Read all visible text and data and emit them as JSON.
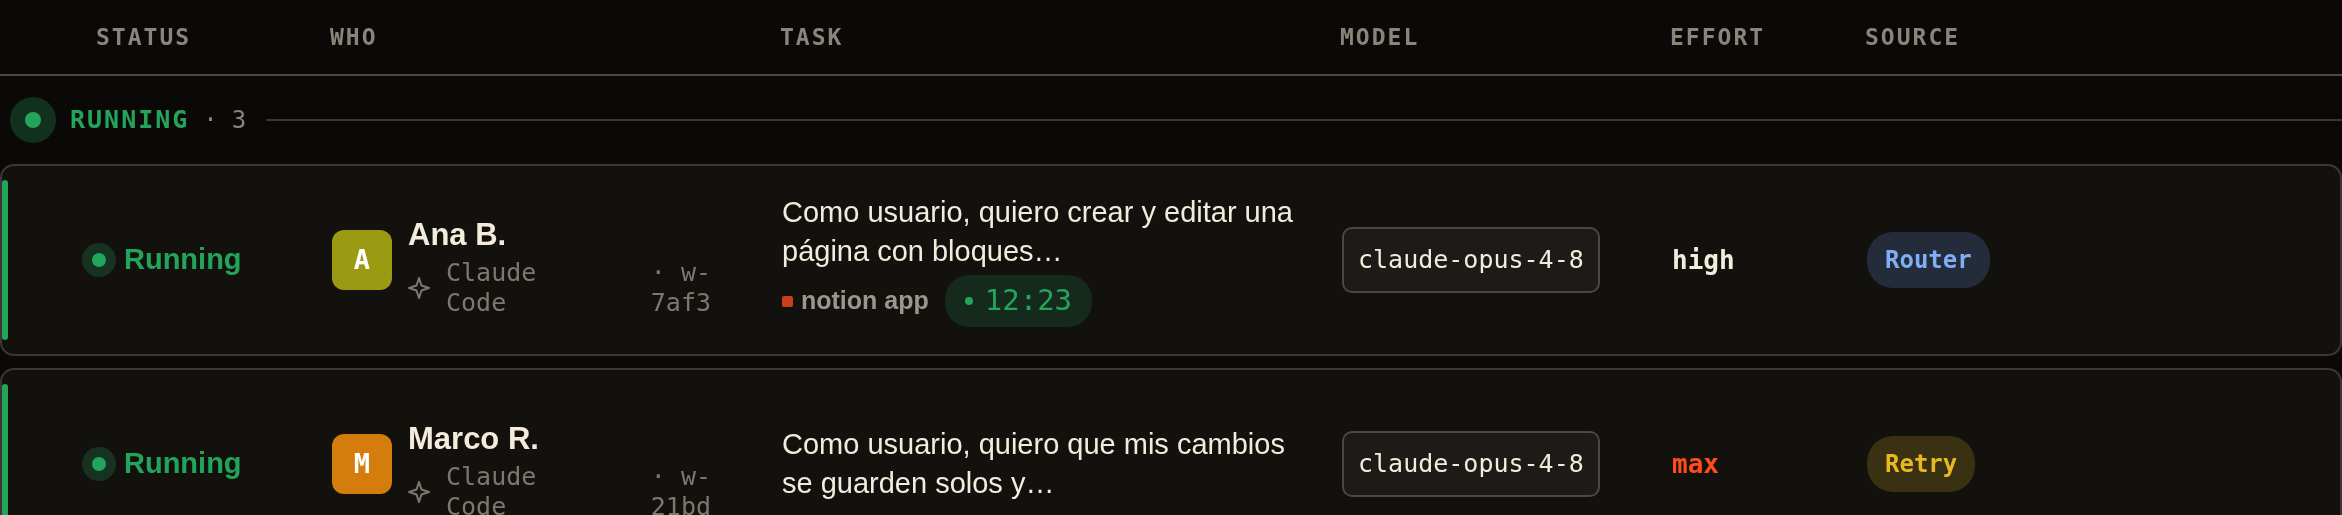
{
  "columns": [
    "STATUS",
    "WHO",
    "TASK",
    "MODEL",
    "EFFORT",
    "SOURCE"
  ],
  "group": {
    "kind": "running",
    "label": "RUNNING",
    "separator": "·",
    "count": "3"
  },
  "rows": [
    {
      "status": {
        "kind": "running",
        "label": "Running"
      },
      "avatar": {
        "initial": "A",
        "color": "#9c9a12"
      },
      "name": "Ana B.",
      "agent": "Claude Code",
      "session": "· w-7af3",
      "task": "Como usuario, quiero crear y editar una página con bloques…",
      "project": {
        "label": "notion app",
        "color": "#c9401a"
      },
      "elapsed": "12:23",
      "model": "claude-opus-4-8",
      "effort": {
        "label": "high",
        "color": "#f3ecdc"
      },
      "source": {
        "kind": "router",
        "label": "Router"
      }
    },
    {
      "status": {
        "kind": "running",
        "label": "Running"
      },
      "avatar": {
        "initial": "M",
        "color": "#d47c0c"
      },
      "name": "Marco R.",
      "agent": "Claude Code",
      "session": "· w-21bd",
      "task": "Como usuario, quiero que mis cambios se guarden solos y…",
      "model": "claude-opus-4-8",
      "effort": {
        "label": "max",
        "color": "#ff4d1a"
      },
      "source": {
        "kind": "retry",
        "label": "Retry"
      }
    }
  ]
}
